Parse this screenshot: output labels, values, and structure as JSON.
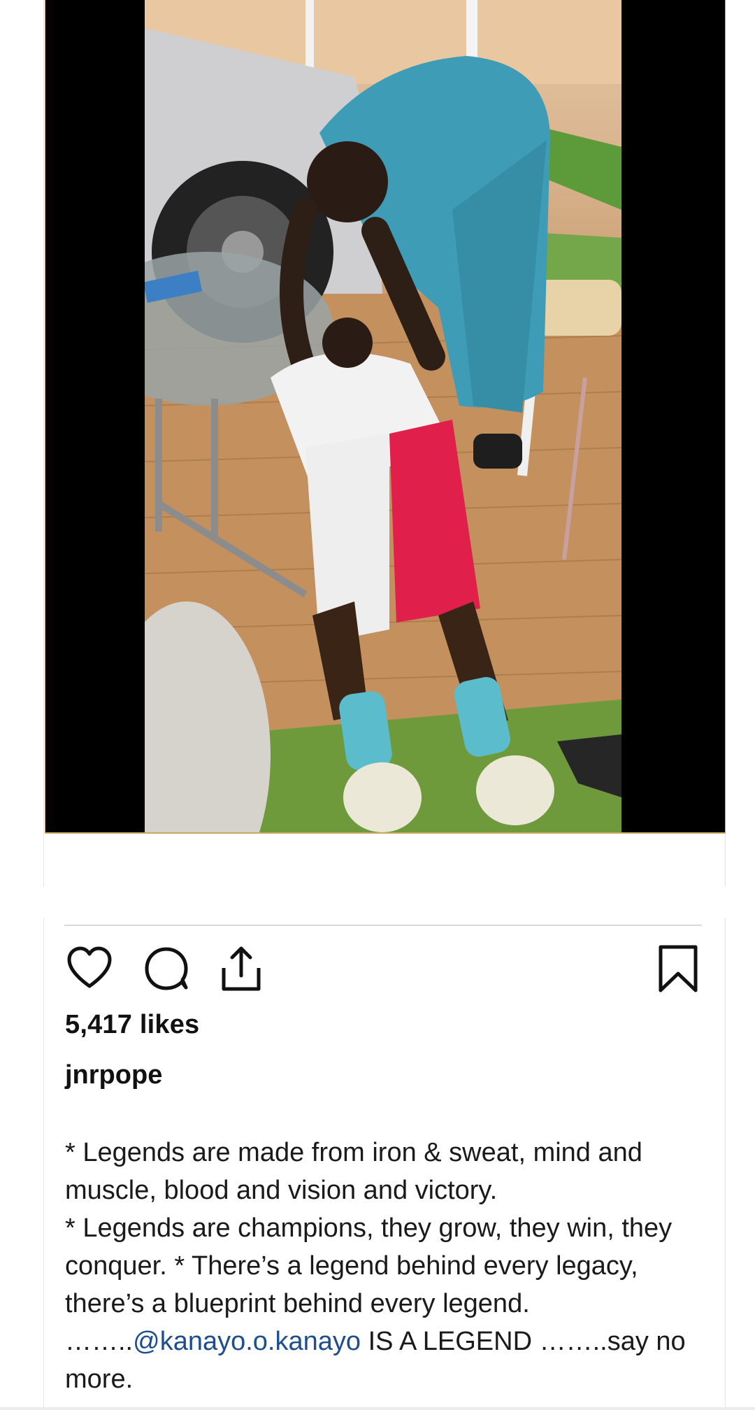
{
  "post": {
    "likes": "5,417 likes",
    "username": "jnrpope",
    "caption": {
      "line1": "* Legends are made from iron & sweat, mind and muscle, blood and vision and victory.",
      "line2": "* Legends are champions, they grow, they win, they conquer. * There’s a legend behind every legacy, there’s a blueprint behind every legend.",
      "prefix": "……..",
      "mention": "@kanayo.o.kanayo",
      "suffix": " IS A LEGEND ……..say no more."
    }
  },
  "actions": {
    "like_icon": "heart-icon",
    "comment_icon": "comment-bubble-icon",
    "share_icon": "share-icon",
    "save_icon": "bookmark-icon"
  },
  "colors": {
    "mention": "#1d4f8c",
    "media_border": "#c8a860",
    "divider": "#d9d9d9"
  }
}
